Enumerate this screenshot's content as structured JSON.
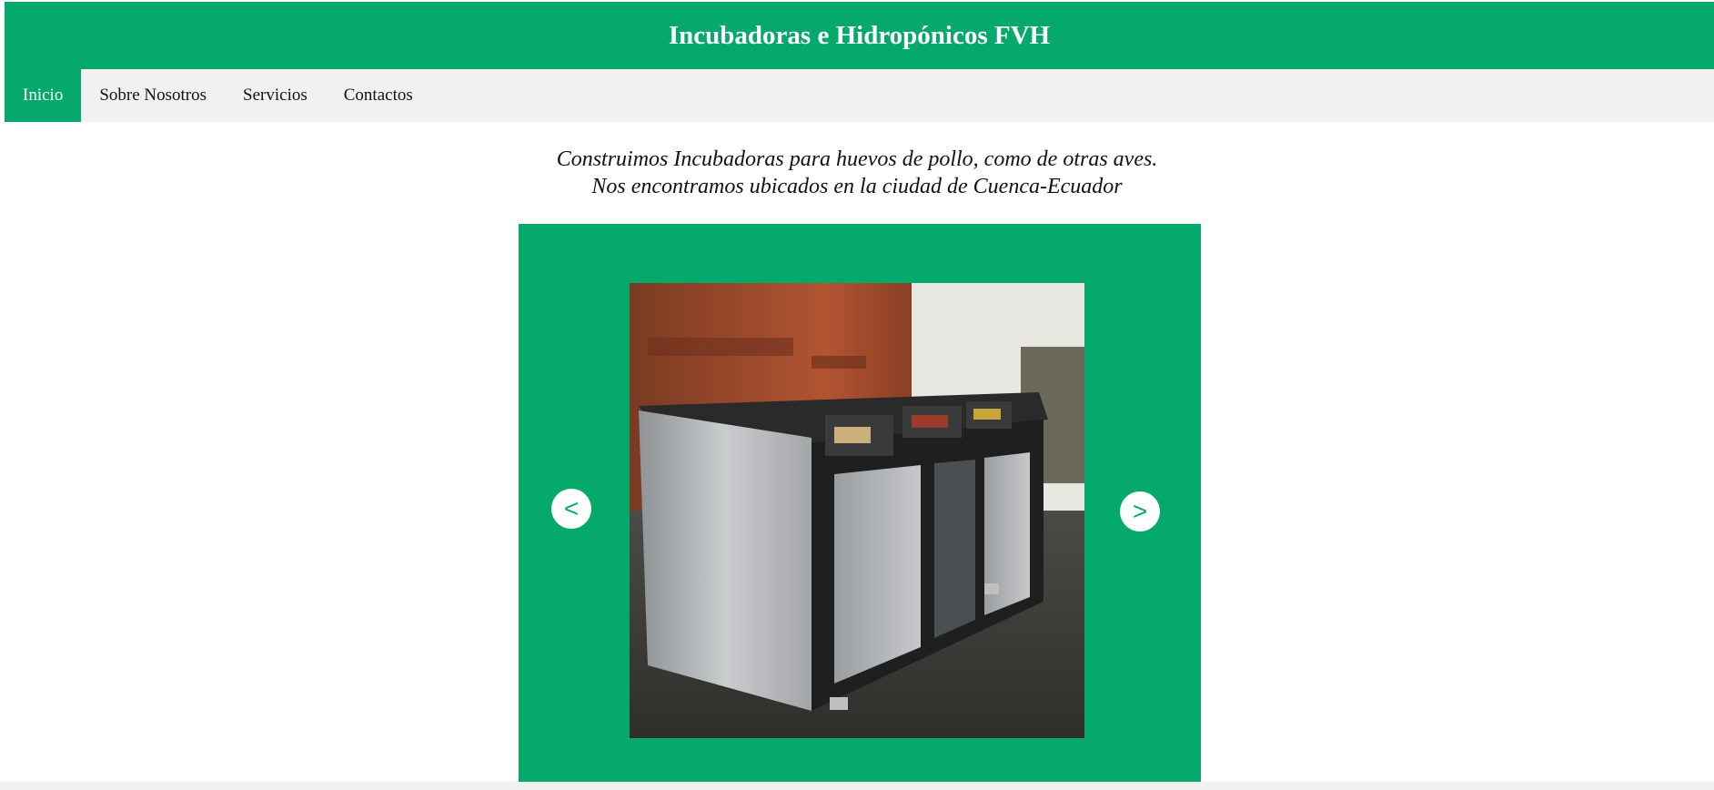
{
  "header": {
    "title": "Incubadoras e Hidropónicos FVH"
  },
  "nav": {
    "items": [
      {
        "label": "Inicio",
        "active": true
      },
      {
        "label": "Sobre Nosotros",
        "active": false
      },
      {
        "label": "Servicios",
        "active": false
      },
      {
        "label": "Contactos",
        "active": false
      }
    ]
  },
  "intro": {
    "line1": "Construimos Incubadoras para huevos de pollo, como de otras aves.",
    "line2": "Nos encontramos ubicados en la ciudad de Cuenca-Ecuador"
  },
  "slider": {
    "prev_label": "<",
    "next_label": ">",
    "prev_icon": "chevron-left-icon",
    "next_icon": "chevron-right-icon"
  },
  "colors": {
    "brand_green": "#04a96b",
    "nav_background": "#f1f1f1",
    "text": "#111111"
  }
}
